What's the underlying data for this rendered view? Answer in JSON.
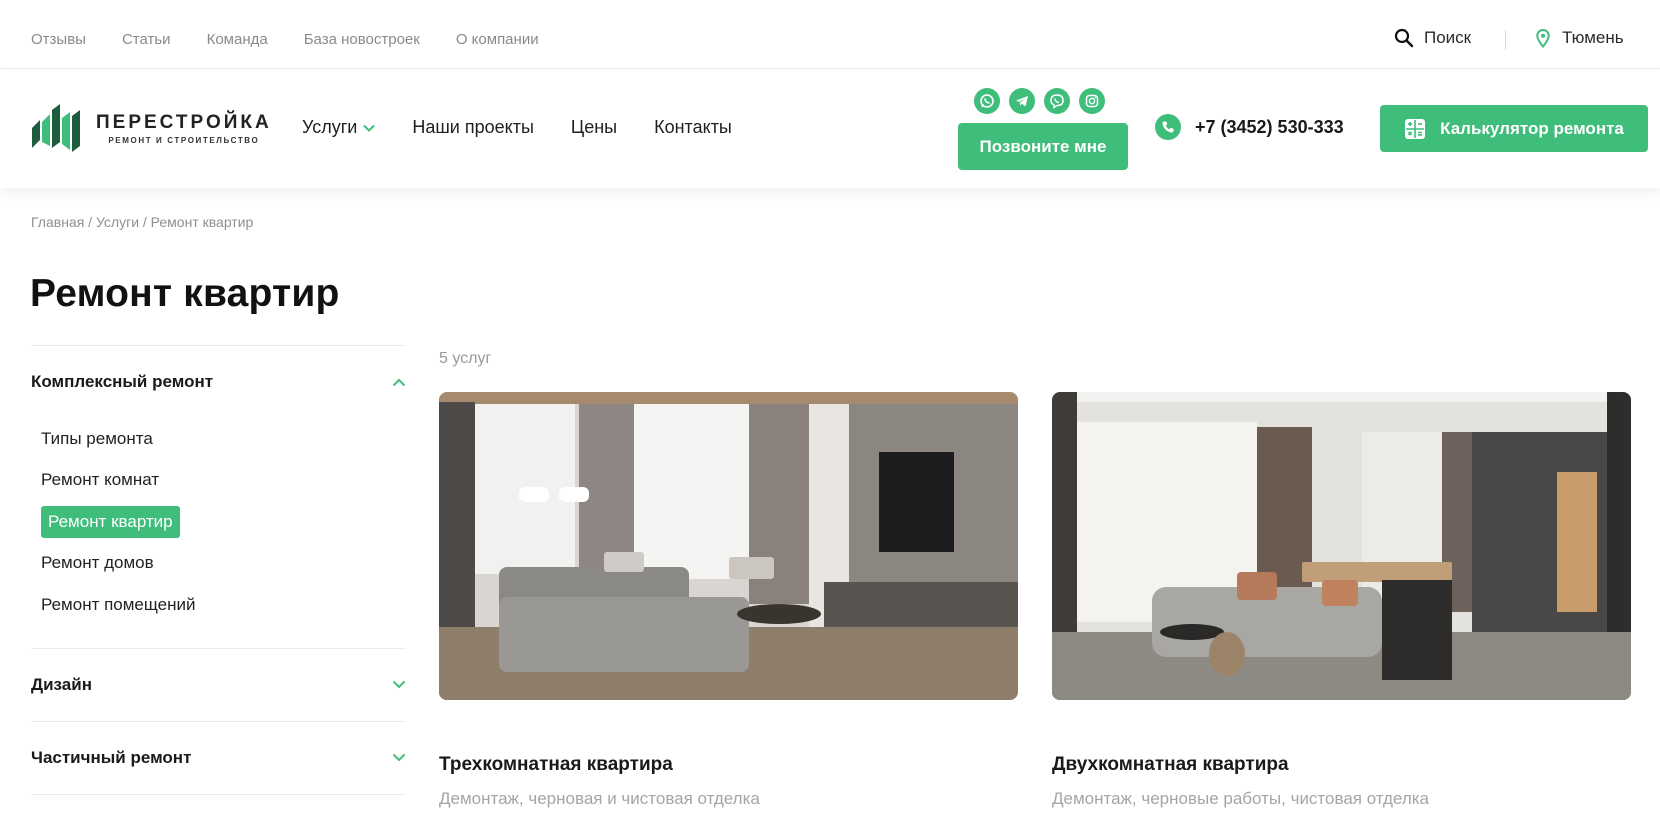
{
  "topbar": {
    "links": [
      "Отзывы",
      "Статьи",
      "Команда",
      "База новостроек",
      "О компании"
    ],
    "search_label": "Поиск",
    "city": "Тюмень"
  },
  "logo": {
    "brand": "ПЕРЕСТРОЙКА",
    "tagline": "РЕМОНТ И СТРОИТЕЛЬСТВО"
  },
  "nav": {
    "services": "Услуги",
    "projects": "Наши проекты",
    "prices": "Цены",
    "contacts": "Контакты"
  },
  "header": {
    "socials": [
      "whatsapp-icon",
      "telegram-icon",
      "viber-icon",
      "instagram-icon"
    ],
    "call_me": "Позвоните мне",
    "phone": "+7 (3452) 530-333",
    "calculator": "Калькулятор ремонта"
  },
  "breadcrumb": "Главная / Услуги / Ремонт квартир",
  "page_title": "Ремонт квартир",
  "sidebar": {
    "sections": [
      {
        "label": "Комплексный ремонт",
        "expanded": true
      },
      {
        "label": "Дизайн",
        "expanded": false
      },
      {
        "label": "Частичный ремонт",
        "expanded": false
      }
    ],
    "items": [
      "Типы ремонта",
      "Ремонт комнат",
      "Ремонт квартир",
      "Ремонт домов",
      "Ремонт помещений"
    ],
    "active_item": "Ремонт квартир"
  },
  "services_count": "5 услуг",
  "cards": [
    {
      "title": "Трехкомнатная квартира",
      "description": "Демонтаж, черновая и чистовая отделка"
    },
    {
      "title": "Двухкомнатная квартира",
      "description": "Демонтаж, черновые работы, чистовая отделка"
    }
  ],
  "colors": {
    "accent": "#3fbd7a"
  }
}
